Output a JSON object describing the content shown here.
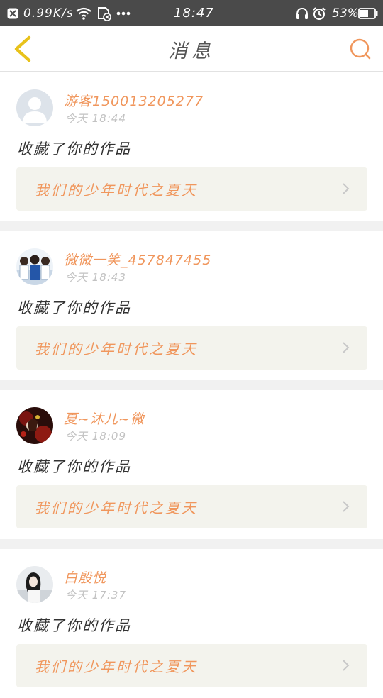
{
  "status_bar": {
    "net_speed": "0.99K/s",
    "time": "18:47",
    "battery_percent": "53%",
    "icons": [
      "notification-close-icon",
      "wifi-icon",
      "no-sim-icon",
      "more-dots-icon",
      "headset-icon",
      "alarm-icon",
      "battery-icon"
    ]
  },
  "header": {
    "title": "消息",
    "back_icon": "chevron-left-icon",
    "search_icon": "search-icon",
    "accent_color": "#f0965c",
    "back_color": "#e8c21b"
  },
  "messages": [
    {
      "username": "游客15001320527​7",
      "time": "今天 18:44",
      "action": "收藏了你的作品",
      "work_title": "我们的少年时代之夏天",
      "avatar": "default-avatar"
    },
    {
      "username": "微微一笑_457847455",
      "time": "今天 18:43",
      "action": "收藏了你的作品",
      "work_title": "我们的少年时代之夏天",
      "avatar": "group-photo-avatar"
    },
    {
      "username": "夏~沐儿~微",
      "time": "今天 18:09",
      "action": "收藏了你的作品",
      "work_title": "我们的少年时代之夏天",
      "avatar": "red-flower-avatar"
    },
    {
      "username": "白殷悦",
      "time": "今天 17:37",
      "action": "收藏了你的作品",
      "work_title": "我们的少年时代之夏天",
      "avatar": "girl-photo-avatar"
    }
  ]
}
